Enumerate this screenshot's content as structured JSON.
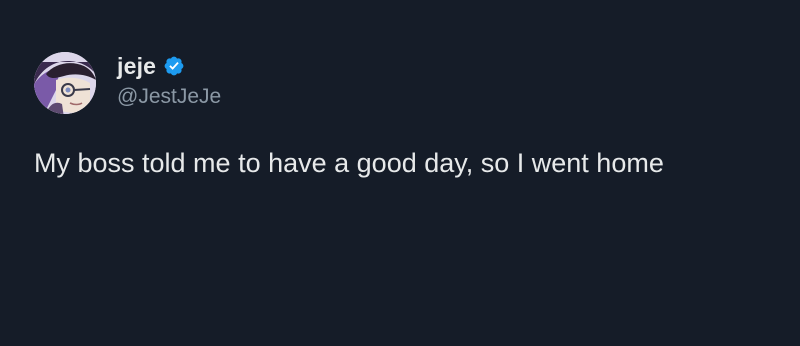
{
  "tweet": {
    "author": {
      "display_name": "jeje",
      "handle": "@JestJeJe",
      "verified_icon": "verified-badge-icon",
      "avatar_icon": "avatar-illustration"
    },
    "text": "My boss told me to have a good day, so I went home"
  },
  "colors": {
    "background": "#151c28",
    "primary_text": "#e7e9ea",
    "secondary_text": "#8b98a5",
    "verified_blue": "#1d9bf0"
  }
}
